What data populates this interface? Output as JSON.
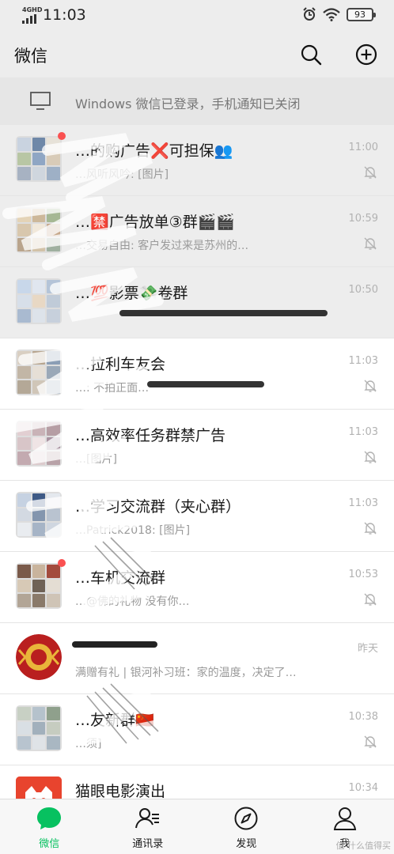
{
  "status_bar": {
    "network": "4GHD",
    "time": "11:03",
    "battery": "93"
  },
  "header": {
    "title": "微信"
  },
  "pc_banner": {
    "text": "Windows 微信已登录，手机通知已关闭"
  },
  "chats": [
    {
      "name": "…的购广告❌可担保👥",
      "preview": "…风听风吟: [图片]",
      "time": "11:00",
      "muted": true,
      "pinned": true
    },
    {
      "name": "…🈲广告放单③群🎬🎬",
      "preview": "…交易自由: 客户发过来是苏州的…",
      "time": "10:59",
      "muted": true,
      "pinned": true
    },
    {
      "name": "…💯影票💸卷群",
      "preview": "",
      "time": "10:50",
      "muted": false,
      "pinned": true
    },
    {
      "name": "…拉利车友会",
      "preview": "…: 不拍正面…",
      "time": "11:03",
      "muted": true,
      "pinned": false
    },
    {
      "name": "…高效率任务群禁广告",
      "preview": "…[图片]",
      "time": "11:03",
      "muted": true,
      "pinned": false
    },
    {
      "name": "…学习交流群（夹心群）",
      "preview": "…Patrick2018: [图片]",
      "time": "11:03",
      "muted": true,
      "pinned": false
    },
    {
      "name": "…车机交流群",
      "preview": "…@佛的礼物 没有你…",
      "time": "10:53",
      "muted": true,
      "pinned": false
    },
    {
      "name": "",
      "preview": "满赠有礼 | 银河补习班：家的温度，决定了…",
      "time": "昨天",
      "muted": false,
      "pinned": false
    },
    {
      "name": "…友新群🇨🇳",
      "preview": "…须]",
      "time": "10:38",
      "muted": true,
      "pinned": false
    },
    {
      "name": "猫眼电影演出",
      "preview": "",
      "time": "10:34",
      "muted": false,
      "pinned": false
    }
  ],
  "tabs": [
    {
      "label": "微信",
      "icon": "chat-bubble-icon",
      "active": true
    },
    {
      "label": "通讯录",
      "icon": "contacts-icon",
      "active": false
    },
    {
      "label": "发现",
      "icon": "compass-icon",
      "active": false
    },
    {
      "label": "我",
      "icon": "person-icon",
      "active": false
    }
  ],
  "watermark": "值 什么值得买"
}
